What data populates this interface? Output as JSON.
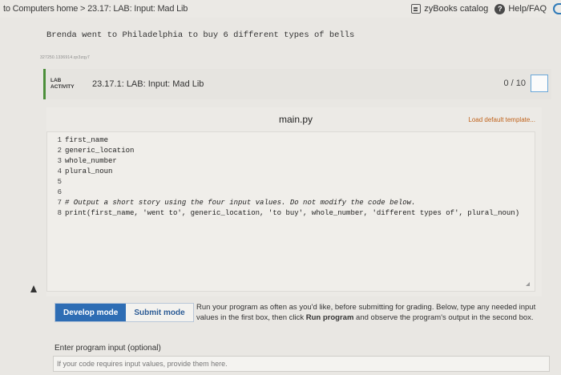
{
  "topbar": {
    "breadcrumb": "to Computers home > 23.17: LAB: Input: Mad Lib",
    "catalog_label": "zyBooks catalog",
    "help_label": "Help/FAQ",
    "help_glyph": "?"
  },
  "prompt": {
    "text": "Brenda went to Philadelphia to buy 6 different types of bells",
    "small_id": "327250.1336914.qx3zqy7"
  },
  "lab": {
    "tag_line1": "LAB",
    "tag_line2": "ACTIVITY",
    "title": "23.17.1: LAB: Input: Mad Lib",
    "score": "0 / 10",
    "accent_color": "#4c8f3a"
  },
  "editor": {
    "file_name": "main.py",
    "load_template_label": "Load default template...",
    "lines": [
      {
        "num": "1",
        "code": "first_name"
      },
      {
        "num": "2",
        "code": "generic_location"
      },
      {
        "num": "3",
        "code": "whole_number"
      },
      {
        "num": "4",
        "code": "plural_noun"
      },
      {
        "num": "5",
        "code": ""
      },
      {
        "num": "6",
        "code": ""
      },
      {
        "num": "7",
        "code": "# Output a short story using the four input values. Do not modify the code below."
      },
      {
        "num": "8",
        "code": "print(first_name, 'went to', generic_location, 'to buy', whole_number, 'different types of', plural_noun)"
      }
    ]
  },
  "modes": {
    "develop_label": "Develop mode",
    "submit_label": "Submit mode",
    "active_color": "#2e6db4"
  },
  "info": {
    "text_before": "Run your program as often as you'd like, before submitting for grading. Below, type any needed input values in the first box, then click ",
    "bold": "Run program",
    "text_after": " and observe the program's output in the second box."
  },
  "program_input": {
    "label": "Enter program input (optional)",
    "placeholder": "If your code requires input values, provide them here."
  }
}
